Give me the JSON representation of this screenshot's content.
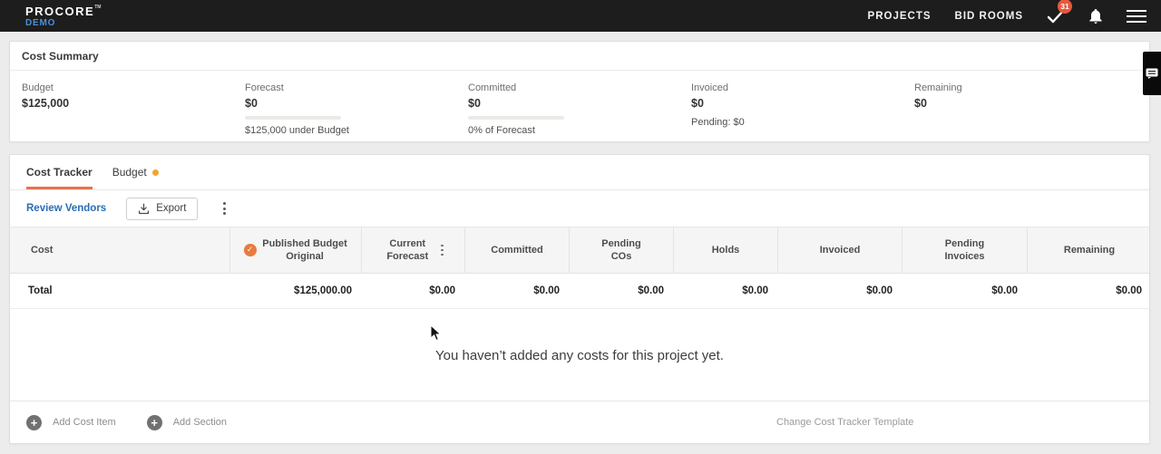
{
  "nav": {
    "logo": "PROCORE",
    "logo_sub": "DEMO",
    "items": [
      {
        "label": "PROJECTS"
      },
      {
        "label": "BID ROOMS"
      }
    ],
    "badge": "31"
  },
  "summary": {
    "title": "Cost Summary",
    "metrics": [
      {
        "label": "Budget",
        "value": "$125,000",
        "sub": ""
      },
      {
        "label": "Forecast",
        "value": "$0",
        "sub": "$125,000 under Budget"
      },
      {
        "label": "Committed",
        "value": "$0",
        "sub": "0% of Forecast"
      },
      {
        "label": "Invoiced",
        "value": "$0",
        "sub": "Pending: $0"
      },
      {
        "label": "Remaining",
        "value": "$0",
        "sub": ""
      }
    ]
  },
  "tabs": [
    {
      "label": "Cost Tracker",
      "active": true
    },
    {
      "label": "Budget",
      "active": false,
      "dot": true
    }
  ],
  "toolbar": {
    "review_vendors": "Review Vendors",
    "export_label": "Export"
  },
  "table": {
    "columns": [
      "Cost",
      "Published Budget Original",
      "Current Forecast",
      "Committed",
      "Pending COs",
      "Holds",
      "Invoiced",
      "Pending Invoices",
      "Remaining"
    ],
    "total_row": {
      "label": "Total",
      "values": [
        "$125,000.00",
        "$0.00",
        "$0.00",
        "$0.00",
        "$0.00",
        "$0.00",
        "$0.00",
        "$0.00"
      ]
    },
    "empty_message": "You haven’t added any costs for this project yet."
  },
  "footer": {
    "add_cost_item": "Add Cost Item",
    "add_section": "Add Section",
    "change_template": "Change Cost Tracker Template"
  },
  "colors": {
    "accent_orange": "#e8714a",
    "amber_dot": "#f0a62f",
    "link_blue": "#2a6eb5",
    "badge_red": "#e8593d",
    "nav_bg": "#1d1d1d"
  }
}
